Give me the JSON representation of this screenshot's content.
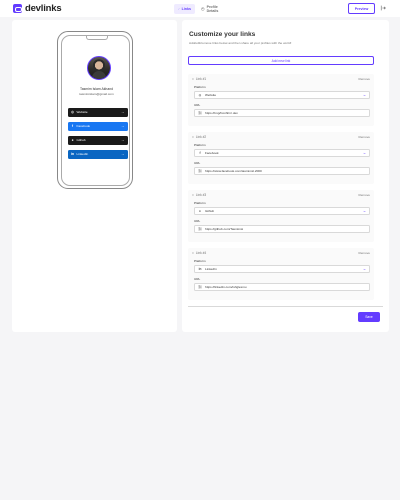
{
  "header": {
    "logo_text": "devlinks",
    "nav_links": "Links",
    "nav_profile": "Profile Details",
    "preview": "Preview"
  },
  "profile": {
    "name": "Tasmim Islam Akhand",
    "email": "tasmimislam@gmail.com"
  },
  "preview_links": [
    {
      "label": "Website",
      "icon": "globe-icon",
      "color": "#1a1a1a"
    },
    {
      "label": "Facebook",
      "icon": "facebook-icon",
      "color": "#1877f2"
    },
    {
      "label": "Github",
      "icon": "github-icon",
      "color": "#1a1a1a"
    },
    {
      "label": "LinkedIn",
      "icon": "linkedin-icon",
      "color": "#0a66c2"
    }
  ],
  "editor": {
    "title": "Customize your links",
    "subtitle": "Add/edit/remove links below and then share all your profiles with the world!",
    "add_label": "Add new link",
    "platform_label": "Platform",
    "url_label": "URL",
    "remove_label": "Remove",
    "save_label": "Save",
    "links": [
      {
        "header": "Link #1",
        "platform": "Website",
        "url": "https://tmg/Confirm/.dev"
      },
      {
        "header": "Link #2",
        "platform": "Facebook",
        "url": "https://www.facebook.com/tasmimsl.2000"
      },
      {
        "header": "Link #3",
        "platform": "Github",
        "url": "https://github.com/Tasmimsi"
      },
      {
        "header": "Link #4",
        "platform": "LinkedIn",
        "url": "https://linkedin.com/in/tglesmu"
      }
    ]
  },
  "colors": {
    "accent": "#633cff",
    "accent_light": "#efebff"
  }
}
